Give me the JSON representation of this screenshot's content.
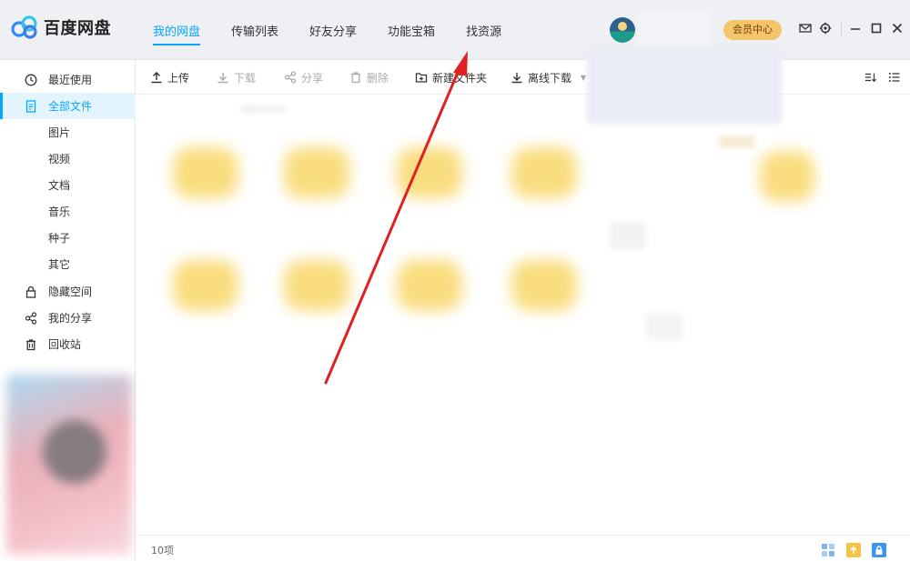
{
  "app": {
    "name": "百度网盘"
  },
  "nav": {
    "tabs": [
      {
        "label": "我的网盘",
        "active": true
      },
      {
        "label": "传输列表",
        "active": false
      },
      {
        "label": "好友分享",
        "active": false
      },
      {
        "label": "功能宝箱",
        "active": false
      },
      {
        "label": "找资源",
        "active": false
      }
    ]
  },
  "header": {
    "vip_label": "会员中心"
  },
  "sidebar": {
    "items": [
      {
        "label": "最近使用",
        "icon": "clock-icon"
      },
      {
        "label": "全部文件",
        "icon": "file-icon",
        "active": true
      },
      {
        "label": "图片"
      },
      {
        "label": "视频"
      },
      {
        "label": "文档"
      },
      {
        "label": "音乐"
      },
      {
        "label": "种子"
      },
      {
        "label": "其它"
      },
      {
        "label": "隐藏空间",
        "icon": "lock-icon"
      },
      {
        "label": "我的分享",
        "icon": "share-icon"
      },
      {
        "label": "回收站",
        "icon": "trash-icon"
      }
    ]
  },
  "toolbar": {
    "upload": "上传",
    "download": "下载",
    "share": "分享",
    "delete": "删除",
    "new_folder": "新建文件夹",
    "offline_download": "离线下载"
  },
  "status": {
    "item_count": "10项"
  },
  "colors": {
    "accent": "#06a7ff",
    "vip": "#f4c56b",
    "annotation": "#e02020"
  }
}
